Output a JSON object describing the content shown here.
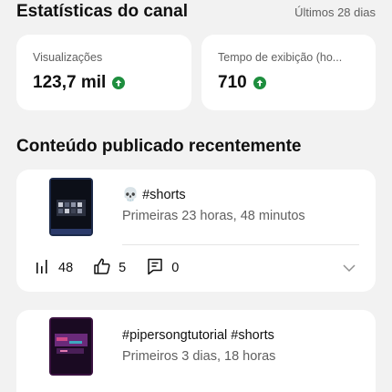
{
  "header": {
    "title": "Estatísticas do canal",
    "period": "Últimos 28 dias"
  },
  "stats": [
    {
      "label": "Visualizações",
      "value": "123,7 mil",
      "trend": "up"
    },
    {
      "label": "Tempo de exibição (ho...",
      "value": "710",
      "trend": "up"
    }
  ],
  "recent": {
    "title": "Conteúdo publicado recentemente",
    "videos": [
      {
        "title_emoji": "💀",
        "title": "#shorts",
        "meta": "Primeiras 23 horas, 48 minutos",
        "views": "48",
        "likes": "5",
        "comments": "0"
      },
      {
        "title": "#pipersongtutorial #shorts",
        "meta": "Primeiros 3 dias, 18 horas"
      }
    ]
  },
  "colors": {
    "trend_up": "#1e8e3e",
    "secondary_text": "#606060",
    "card_background": "#ffffff",
    "page_background": "#f2f2f2"
  },
  "icons": [
    "arrow-up-icon",
    "bar-chart-icon",
    "thumbs-up-icon",
    "comment-icon",
    "chevron-down-icon"
  ]
}
